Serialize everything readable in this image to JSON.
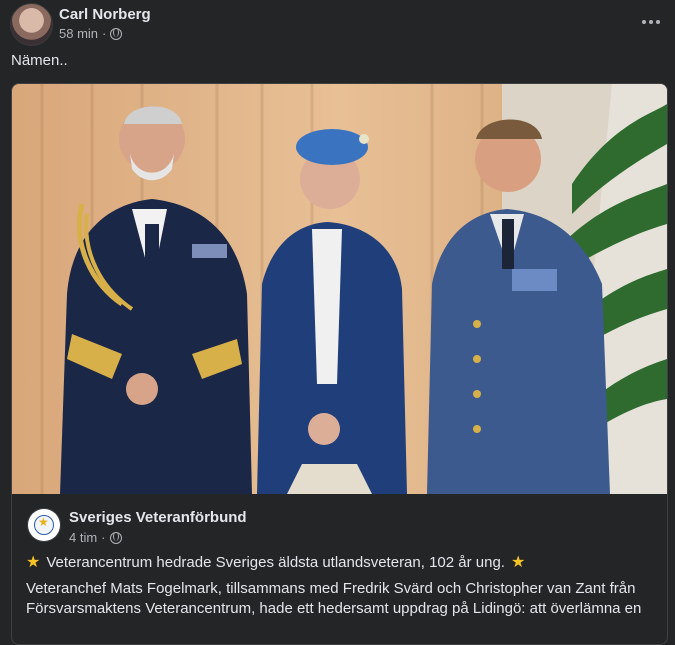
{
  "post": {
    "author": "Carl Norberg",
    "time": "58 min",
    "separator": "·",
    "text": "Nämen.."
  },
  "shared_post": {
    "page_name": "Sveriges Veteranförbund",
    "time": "4 tim",
    "separator": "·",
    "headline": "Veterancentrum hedrade Sveriges äldsta utlandsveteran, 102 år ung.",
    "body": "Veteranchef Mats Fogelmark, tillsammans med Fredrik Svärd och Christopher van Zant från Försvarsmaktens Veterancentrum, hade ett hedersamt uppdrag på Lidingö: att överlämna en"
  },
  "icons": {
    "privacy": "globe-icon",
    "more": "more-options-icon",
    "headline_decoration": "star-icon"
  },
  "colors": {
    "background": "#242526",
    "text": "#e4e6eb",
    "secondary_text": "#b0b3b8",
    "star": "#f7c523"
  }
}
